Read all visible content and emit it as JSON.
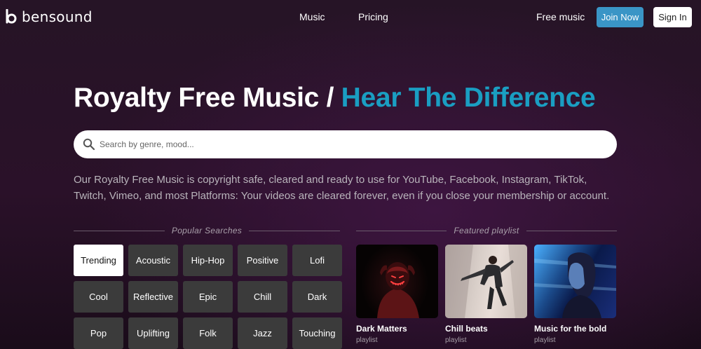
{
  "header": {
    "logo_text": "bensound",
    "nav": {
      "music": "Music",
      "pricing": "Pricing",
      "free_music": "Free music"
    },
    "join_label": "Join Now",
    "signin_label": "Sign In"
  },
  "hero": {
    "title_main": "Royalty Free Music / ",
    "title_accent": "Hear The Difference",
    "accent_color": "#1a9ec2"
  },
  "search": {
    "placeholder": "Search by genre, mood..."
  },
  "description": "Our Royalty Free Music is copyright safe, cleared and ready to use for YouTube, Facebook, Instagram, TikTok, Twitch, Vimeo, and most Platforms: Your videos are cleared forever, even if you close your membership or account.",
  "popular": {
    "label": "Popular Searches",
    "tags": [
      "Trending",
      "Acoustic",
      "Hip-Hop",
      "Positive",
      "Lofi",
      "Cool",
      "Reflective",
      "Epic",
      "Chill",
      "Dark",
      "Pop",
      "Uplifting",
      "Folk",
      "Jazz",
      "Touching"
    ]
  },
  "featured": {
    "label": "Featured playlist",
    "playlists": [
      {
        "title": "Dark Matters",
        "type": "playlist"
      },
      {
        "title": "Chill beats",
        "type": "playlist"
      },
      {
        "title": "Music for the bold",
        "type": "playlist"
      }
    ]
  }
}
